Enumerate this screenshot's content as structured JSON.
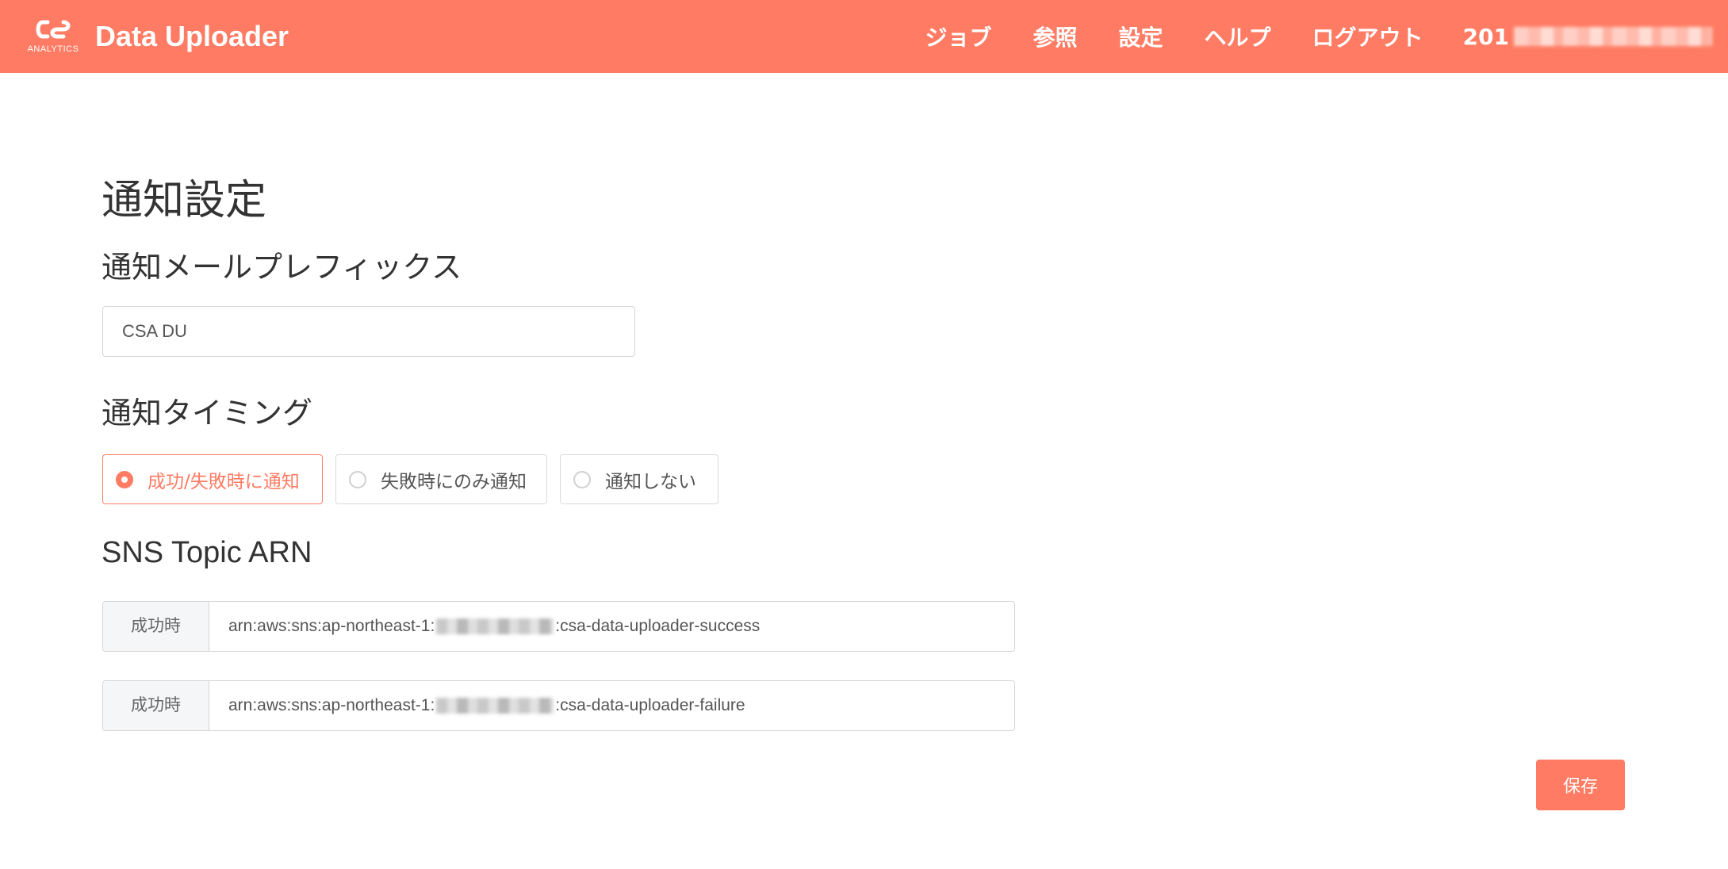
{
  "header": {
    "logo_text": "ANALYTICS",
    "title": "Data Uploader",
    "nav": [
      {
        "label": "ジョブ"
      },
      {
        "label": "参照"
      },
      {
        "label": "設定"
      },
      {
        "label": "ヘルプ"
      },
      {
        "label": "ログアウト"
      }
    ],
    "user_prefix": "201"
  },
  "page": {
    "title": "通知設定"
  },
  "prefix": {
    "heading": "通知メールプレフィックス",
    "value": "CSA DU"
  },
  "timing": {
    "heading": "通知タイミング",
    "options": [
      {
        "label": "成功/失敗時に通知",
        "selected": true
      },
      {
        "label": "失敗時にのみ通知",
        "selected": false
      },
      {
        "label": "通知しない",
        "selected": false
      }
    ]
  },
  "arn": {
    "heading": "SNS Topic ARN",
    "rows": [
      {
        "addon": "成功時",
        "prefix": "arn:aws:sns:ap-northeast-1:",
        "suffix": ":csa-data-uploader-success"
      },
      {
        "addon": "成功時",
        "prefix": "arn:aws:sns:ap-northeast-1:",
        "suffix": ":csa-data-uploader-failure"
      }
    ]
  },
  "actions": {
    "save_label": "保存"
  },
  "colors": {
    "accent": "#ff7b63",
    "text": "#333333",
    "border": "#d5d5d5"
  }
}
